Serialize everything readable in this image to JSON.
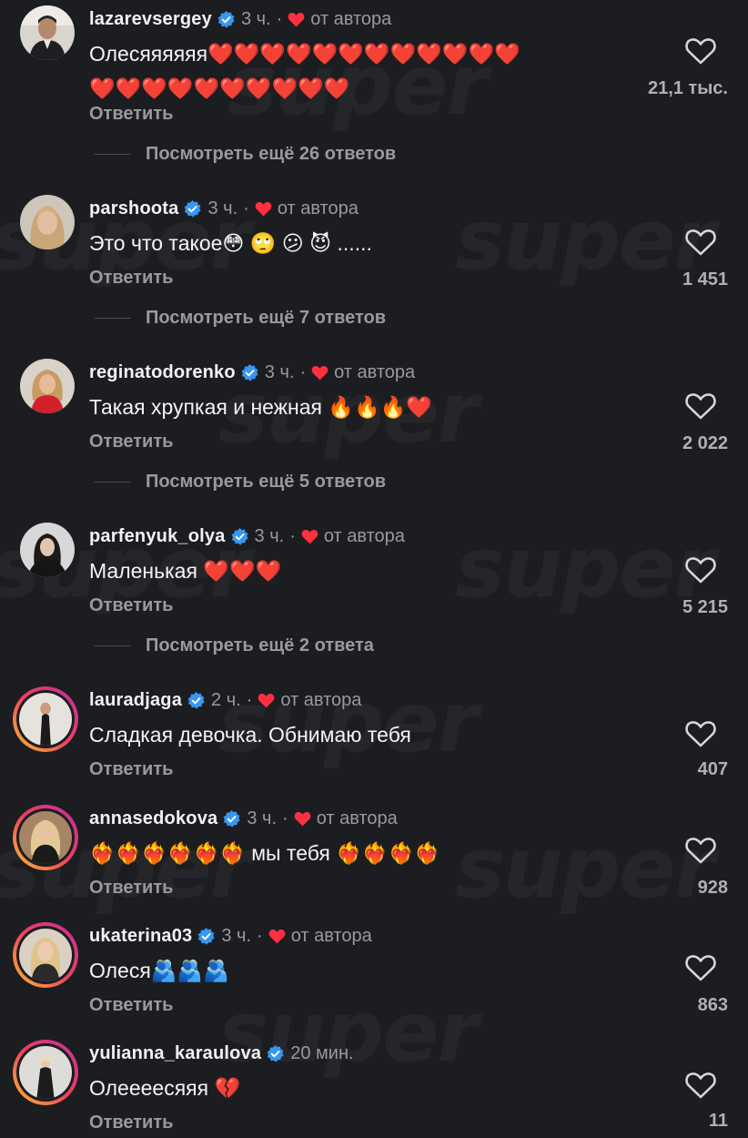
{
  "ui": {
    "reply_label": "Ответить",
    "author_label": "от автора",
    "dot": "·",
    "colors": {
      "background": "#1c1d20",
      "text": "#f2f2f2",
      "muted": "#9a9a9e",
      "verified": "#3897f0",
      "heart": "#ff3040"
    }
  },
  "watermark": "super",
  "comments": [
    {
      "username": "lazarevsergey",
      "verified": true,
      "time": "3 ч.",
      "liked_by_author": true,
      "text_line1": "Олесяяяяяя❤️❤️❤️❤️❤️❤️❤️❤️❤️❤️❤️❤️",
      "text_line2": "❤️❤️❤️❤️❤️❤️❤️❤️❤️❤️",
      "likes": "21,1 тыс.",
      "more_replies": "Посмотреть ещё 26 ответов",
      "avatar_icon": "avatar-photo"
    },
    {
      "username": "parshoota",
      "verified": true,
      "time": "3 ч.",
      "liked_by_author": true,
      "text": "Это что такое😳 🙄 😕 😈 ......",
      "likes": "1 451",
      "more_replies": "Посмотреть ещё 7 ответов",
      "avatar_icon": "avatar-photo"
    },
    {
      "username": "reginatodorenko",
      "verified": true,
      "time": "3 ч.",
      "liked_by_author": true,
      "text": "Такая хрупкая и нежная 🔥🔥🔥❤️",
      "likes": "2 022",
      "more_replies": "Посмотреть ещё 5 ответов",
      "avatar_icon": "avatar-photo"
    },
    {
      "username": "parfenyuk_olya",
      "verified": true,
      "time": "3 ч.",
      "liked_by_author": true,
      "text": "Маленькая ❤️❤️❤️",
      "likes": "5 215",
      "more_replies": "Посмотреть ещё 2 ответа",
      "avatar_icon": "avatar-photo"
    },
    {
      "username": "lauradjaga",
      "verified": true,
      "time": "2 ч.",
      "liked_by_author": true,
      "text": "Сладкая девочка. Обнимаю тебя",
      "likes": "407",
      "avatar_icon": "avatar-photo-story"
    },
    {
      "username": "annasedokova",
      "verified": true,
      "time": "3 ч.",
      "liked_by_author": true,
      "text": "❤️‍🔥❤️‍🔥❤️‍🔥❤️‍🔥❤️‍🔥❤️‍🔥 мы тебя ❤️‍🔥❤️‍🔥❤️‍🔥❤️‍🔥",
      "likes": "928",
      "avatar_icon": "avatar-photo-story"
    },
    {
      "username": "ukaterina03",
      "verified": true,
      "time": "3 ч.",
      "liked_by_author": true,
      "text": "Олеся🫂🫂🫂",
      "likes": "863",
      "avatar_icon": "avatar-photo-story"
    },
    {
      "username": "yulianna_karaulova",
      "verified": true,
      "time": "20 мин.",
      "liked_by_author": false,
      "text": "Олееееся​яя 💔",
      "likes": "11",
      "avatar_icon": "avatar-photo-story"
    }
  ]
}
